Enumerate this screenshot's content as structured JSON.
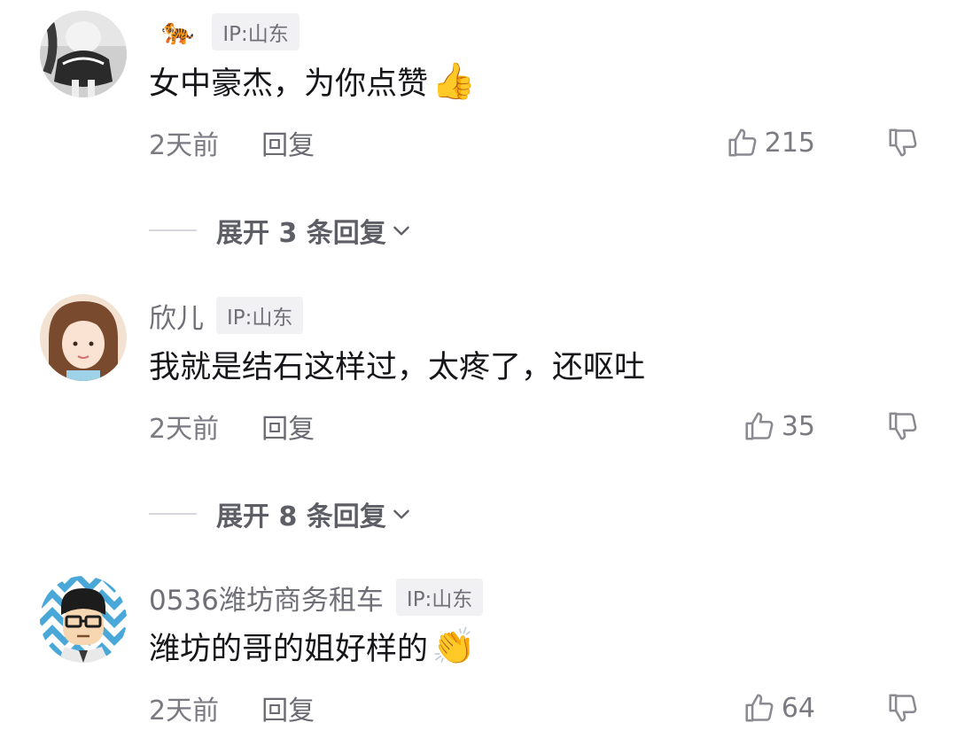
{
  "comments": [
    {
      "username": "",
      "user_emoji": "🐅",
      "ip": "IP:山东",
      "text": "女中豪杰，为你点赞",
      "text_emoji": "👍",
      "time": "2天前",
      "reply": "回复",
      "likes": "215",
      "expand": "展开 3 条回复"
    },
    {
      "username": "欣儿",
      "ip": "IP:山东",
      "text": "我就是结石这样过，太疼了，还呕吐",
      "time": "2天前",
      "reply": "回复",
      "likes": "35",
      "expand": "展开 8 条回复"
    },
    {
      "username": "0536潍坊商务租车",
      "ip": "IP:山东",
      "text": "潍坊的哥的姐好样的",
      "text_emoji": "👏",
      "time": "2天前",
      "reply": "回复",
      "likes": "64"
    }
  ],
  "icons": {
    "like": "thumbs-up-outline-icon",
    "dislike": "thumbs-down-outline-icon",
    "expand": "chevron-down-icon"
  },
  "colors": {
    "text": "#16161a",
    "secondary": "#7a7a82",
    "badge_bg": "#f1f1f3"
  }
}
